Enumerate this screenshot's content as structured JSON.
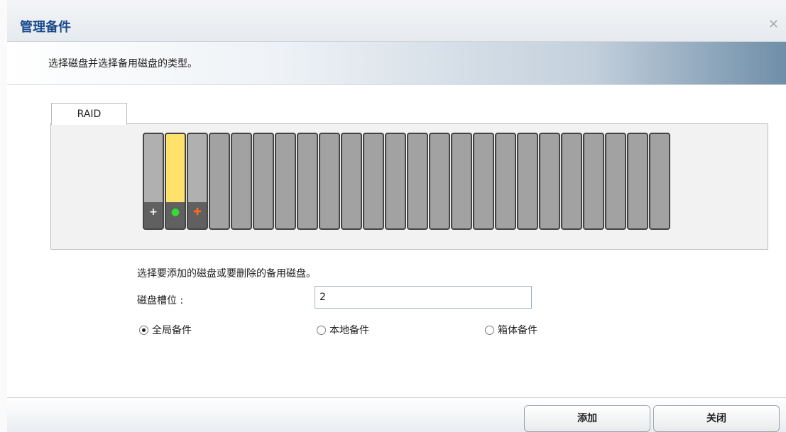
{
  "dialog": {
    "title": "管理备件",
    "close_glyph": "✕",
    "instruction": "选择磁盘并选择备用磁盘的类型。"
  },
  "tab": {
    "label": "RAID"
  },
  "disks": [
    {
      "state": "spare",
      "indicator": "+",
      "indicator_color": "#ffffff",
      "selected": false
    },
    {
      "state": "selected",
      "indicator": "●",
      "indicator_color": "#33dd33",
      "selected": true
    },
    {
      "state": "in-use",
      "indicator": "✚",
      "indicator_color": "#ff6a1e",
      "selected": false
    },
    {
      "state": "empty"
    },
    {
      "state": "empty"
    },
    {
      "state": "empty"
    },
    {
      "state": "empty"
    },
    {
      "state": "empty"
    },
    {
      "state": "empty"
    },
    {
      "state": "empty"
    },
    {
      "state": "empty"
    },
    {
      "state": "empty"
    },
    {
      "state": "empty"
    },
    {
      "state": "empty"
    },
    {
      "state": "empty"
    },
    {
      "state": "empty"
    },
    {
      "state": "empty"
    },
    {
      "state": "empty"
    },
    {
      "state": "empty"
    },
    {
      "state": "empty"
    },
    {
      "state": "empty"
    },
    {
      "state": "empty"
    },
    {
      "state": "empty"
    },
    {
      "state": "empty"
    }
  ],
  "form": {
    "prompt": "选择要添加的磁盘或要删除的备用磁盘。",
    "slot_label": "磁盘槽位 :",
    "slot_value": "2",
    "spare_types": [
      {
        "label": "全局备件",
        "checked": true
      },
      {
        "label": "本地备件",
        "checked": false
      },
      {
        "label": "箱体备件",
        "checked": false
      }
    ]
  },
  "buttons": {
    "add": "添加",
    "close": "关闭"
  }
}
